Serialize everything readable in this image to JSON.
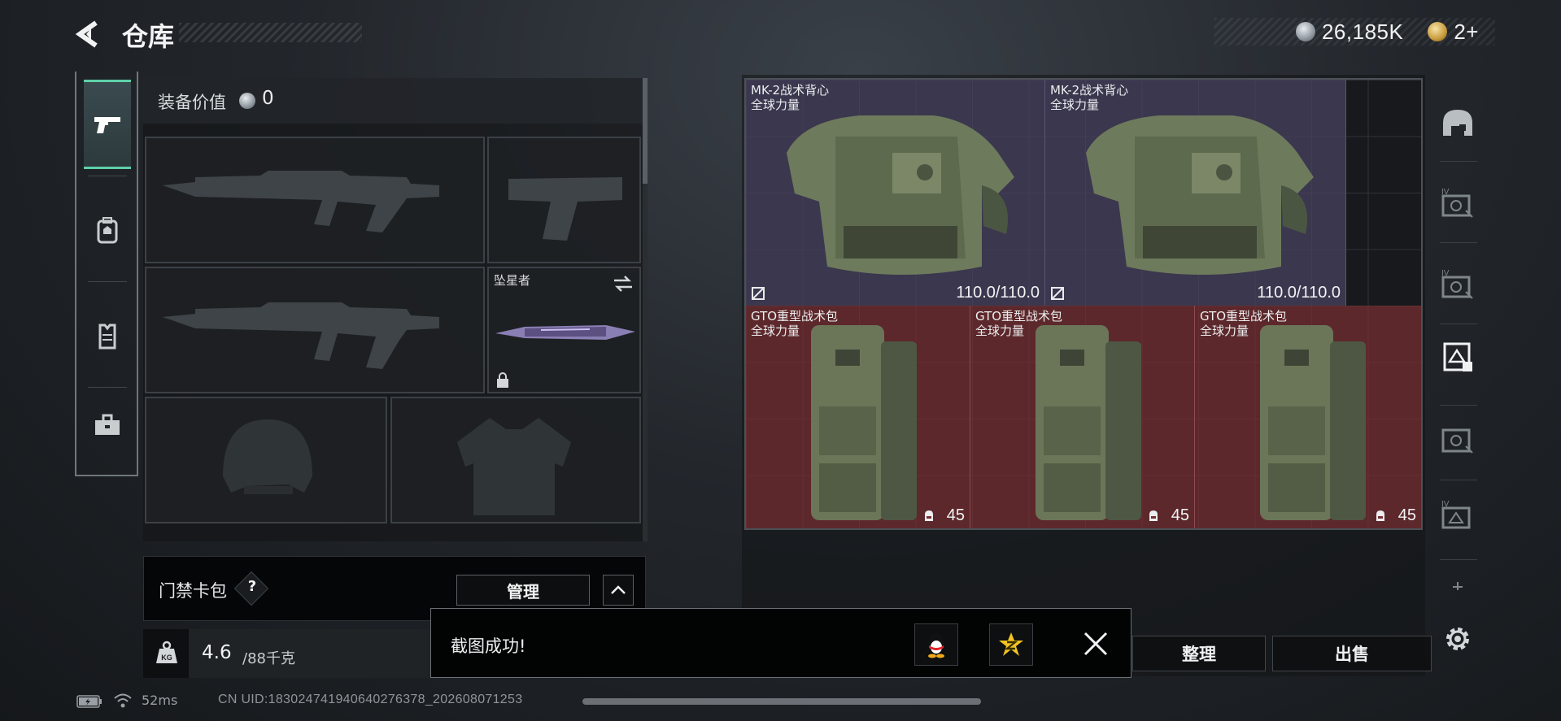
{
  "header": {
    "title": "仓库",
    "currency_main": "26,185K",
    "currency_secondary": "2+"
  },
  "rail": {
    "tabs": [
      {
        "name": "pistol-icon",
        "active": true
      },
      {
        "name": "backpack-icon",
        "active": false
      },
      {
        "name": "vest-icon",
        "active": false
      },
      {
        "name": "toolbox-icon",
        "active": false
      }
    ]
  },
  "equipment": {
    "value_label": "装备价值",
    "value": "0",
    "melee_name": "坠星者"
  },
  "access_card": {
    "label": "门禁卡包",
    "help": "?",
    "manage_label": "管理"
  },
  "weight": {
    "current": "4.6",
    "max": "/88千克"
  },
  "storage": {
    "vests": [
      {
        "name": "MK-2战术背心",
        "faction": "全球力量",
        "durability": "110.0/110.0"
      },
      {
        "name": "MK-2战术背心",
        "faction": "全球力量",
        "durability": "110.0/110.0"
      }
    ],
    "bags": [
      {
        "name": "GTO重型战术包",
        "faction": "全球力量",
        "count": "45"
      },
      {
        "name": "GTO重型战术包",
        "faction": "全球力量",
        "count": "45"
      },
      {
        "name": "GTO重型战术包",
        "faction": "全球力量",
        "count": "45"
      }
    ]
  },
  "actions": {
    "sort_label": "整理",
    "sell_label": "出售"
  },
  "toast": {
    "message": "截图成功!"
  },
  "status": {
    "ping": "52ms",
    "uid": "CN UID:183024741940640276378_202608071253"
  },
  "colors": {
    "accent": "#5fd0a8",
    "vest_bg": "#484262",
    "bag_bg": "#782e32"
  }
}
